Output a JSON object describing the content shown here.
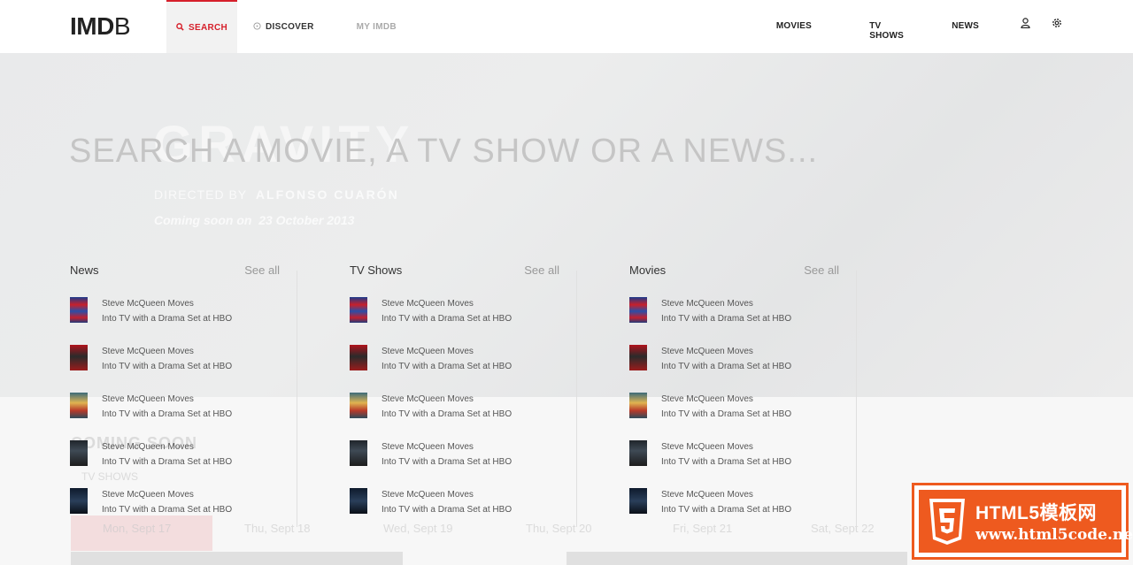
{
  "header": {
    "logo_bold": "IMD",
    "logo_light": "B",
    "nav": {
      "search": "SEARCH",
      "discover": "DISCOVER",
      "myimdb": "MY IMDB",
      "movies": "MOVIES",
      "tvshows": "TV SHOWS",
      "news": "NEWS"
    }
  },
  "hero": {
    "title": "GRAVITY",
    "directed_by": "DIRECTED BY",
    "director": "ALFONSO CUARÓN",
    "coming": "Coming soon on",
    "coming_date": "23 October 2013",
    "coming_soon": "COMING SOON",
    "tab_tvshows": "TV SHOWS",
    "days": [
      "Mon, Sept 17",
      "Thu, Sept 18",
      "Wed, Sept 19",
      "Thu, Sept 20",
      "Fri, Sept 21",
      "Sat, Sept 22"
    ]
  },
  "search": {
    "headline": "SEARCH A MOVIE, A TV SHOW OR A NEWS..."
  },
  "columns": [
    {
      "title": "News",
      "see_all": "See all",
      "items": [
        {
          "line1": "Steve McQueen Moves",
          "line2": "Into TV with a Drama Set at HBO"
        },
        {
          "line1": "Steve McQueen Moves",
          "line2": "Into TV with a Drama Set at HBO"
        },
        {
          "line1": "Steve McQueen Moves",
          "line2": "Into TV with a Drama Set at HBO"
        },
        {
          "line1": "Steve McQueen Moves",
          "line2": "Into TV with a Drama Set at HBO"
        },
        {
          "line1": "Steve McQueen Moves",
          "line2": "Into TV with a Drama Set at HBO"
        }
      ]
    },
    {
      "title": "TV Shows",
      "see_all": "See all",
      "items": [
        {
          "line1": "Steve McQueen Moves",
          "line2": "Into TV with a Drama Set at HBO"
        },
        {
          "line1": "Steve McQueen Moves",
          "line2": "Into TV with a Drama Set at HBO"
        },
        {
          "line1": "Steve McQueen Moves",
          "line2": "Into TV with a Drama Set at HBO"
        },
        {
          "line1": "Steve McQueen Moves",
          "line2": "Into TV with a Drama Set at HBO"
        },
        {
          "line1": "Steve McQueen Moves",
          "line2": "Into TV with a Drama Set at HBO"
        }
      ]
    },
    {
      "title": "Movies",
      "see_all": "See all",
      "items": [
        {
          "line1": "Steve McQueen Moves",
          "line2": "Into TV with a Drama Set at HBO"
        },
        {
          "line1": "Steve McQueen Moves",
          "line2": "Into TV with a Drama Set at HBO"
        },
        {
          "line1": "Steve McQueen Moves",
          "line2": "Into TV with a Drama Set at HBO"
        },
        {
          "line1": "Steve McQueen Moves",
          "line2": "Into TV with a Drama Set at HBO"
        },
        {
          "line1": "Steve McQueen Moves",
          "line2": "Into TV with a Drama Set at HBO"
        }
      ]
    }
  ],
  "watermark": {
    "line1": "HTML5模板网",
    "line2": "www.html5code.net"
  },
  "colors": {
    "accent": "#d6202b",
    "watermark": "#ee5a1f"
  },
  "icons": {
    "search": "search-icon",
    "discover": "compass-icon",
    "user": "user-icon",
    "settings": "gear-icon"
  }
}
